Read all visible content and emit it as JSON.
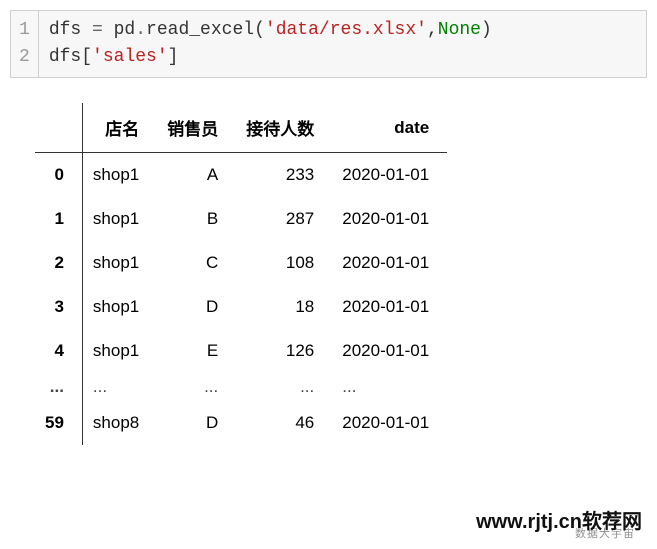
{
  "code": {
    "lines": [
      "1",
      "2"
    ],
    "var": "dfs",
    "assign": " = ",
    "module": "pd",
    "dot1": ".",
    "func": "read_excel",
    "lparen": "(",
    "q1": "'",
    "path": "data/res.xlsx",
    "q2": "'",
    "comma": ",",
    "none": "None",
    "rparen": ")",
    "dfs2": "dfs",
    "lbr": "[",
    "q3": "'",
    "key": "sales",
    "q4": "'",
    "rbr": "]"
  },
  "table": {
    "headers": {
      "idx": "",
      "shop": "店名",
      "sales": "销售员",
      "recv": "接待人数",
      "date": "date"
    },
    "rows": [
      {
        "idx": "0",
        "shop": "shop1",
        "sales": "A",
        "recv": "233",
        "date": "2020-01-01"
      },
      {
        "idx": "1",
        "shop": "shop1",
        "sales": "B",
        "recv": "287",
        "date": "2020-01-01"
      },
      {
        "idx": "2",
        "shop": "shop1",
        "sales": "C",
        "recv": "108",
        "date": "2020-01-01"
      },
      {
        "idx": "3",
        "shop": "shop1",
        "sales": "D",
        "recv": "18",
        "date": "2020-01-01"
      },
      {
        "idx": "4",
        "shop": "shop1",
        "sales": "E",
        "recv": "126",
        "date": "2020-01-01"
      },
      {
        "idx": "...",
        "shop": "...",
        "sales": "...",
        "recv": "...",
        "date": "..."
      },
      {
        "idx": "59",
        "shop": "shop8",
        "sales": "D",
        "recv": "46",
        "date": "2020-01-01"
      }
    ]
  },
  "watermark": {
    "main": "www.rjtj.cn软荐网",
    "sub": "数据大宇宙"
  }
}
